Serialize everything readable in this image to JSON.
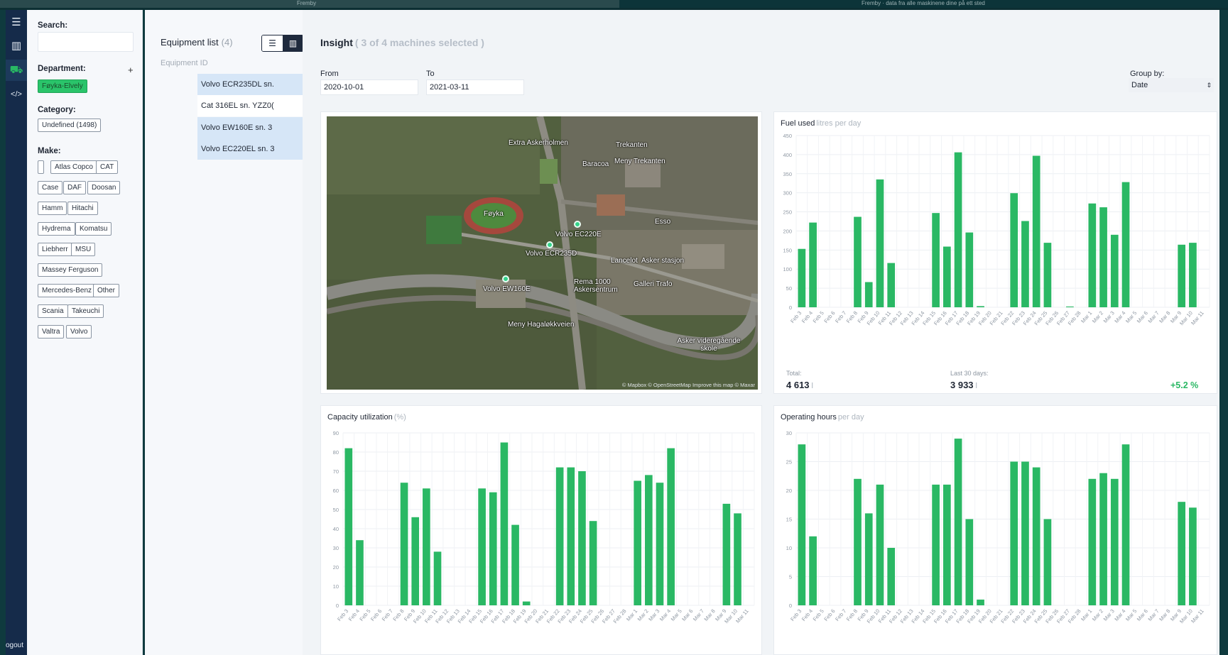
{
  "topbar": {
    "left_text": "Fremby",
    "right_text": "Fremby · data fra alle maskinene dine på ett sted"
  },
  "rail": {
    "items": [
      {
        "icon": "menu-icon",
        "glyph": "☰"
      },
      {
        "icon": "building-icon",
        "glyph": "▥"
      },
      {
        "icon": "machine-icon",
        "glyph": "⛟"
      },
      {
        "icon": "code-icon",
        "glyph": "</>"
      }
    ],
    "logout_label": "ogout"
  },
  "filters": {
    "search_label": "Search:",
    "search_value": "",
    "department_label": "Department:",
    "department_add": "+",
    "department_chips": [
      "Føyka-Elvely"
    ],
    "category_label": "Category:",
    "category_chips": [
      "Undefined (1498)"
    ],
    "make_label": "Make:",
    "make_chips": [
      "",
      "Atlas Copco",
      "CAT",
      "Case",
      "DAF",
      "Doosan",
      "Hamm",
      "Hitachi",
      "Hydrema",
      "Komatsu",
      "Liebherr",
      "MSU",
      "Massey Ferguson",
      "Mercedes-Benz",
      "Other",
      "Scania",
      "Takeuchi",
      "Valtra",
      "Volvo"
    ]
  },
  "equipment": {
    "title": "Equipment list",
    "count": "(4)",
    "column_header": "Equipment ID",
    "rows": [
      {
        "label": "Volvo ECR235DL sn.",
        "selected": true
      },
      {
        "label": "Cat 316EL sn. YZZ0(",
        "selected": false
      },
      {
        "label": "Volvo EW160E sn. 3",
        "selected": true
      },
      {
        "label": "Volvo EC220EL sn. 3",
        "selected": true
      }
    ]
  },
  "insight": {
    "title": "Insight",
    "subtitle": "( 3 of 4 machines selected )",
    "from_label": "From",
    "from_value": "2020-10-01",
    "to_label": "To",
    "to_value": "2021-03-11",
    "group_label": "Group by:",
    "group_value": "Date"
  },
  "map": {
    "labels": [
      "Extra Askerholmen",
      "Trekanten",
      "Baracoa",
      "Meny Trekanten",
      "Føyka",
      "Volvo EC220E",
      "Volvo ECR235D",
      "Volvo EW160E",
      "Lancelot",
      "Asker stasjon",
      "Rema 1000 Askersentrum",
      "Galleri Trafo",
      "Meny Hagaløkkveien",
      "Asker videregående skole",
      "Esso"
    ],
    "attribution": "© Mapbox © OpenStreetMap Improve this map © Maxar"
  },
  "colors": {
    "bar": "#2ab864",
    "accent": "#2ac46a",
    "rail": "#152b4a"
  },
  "fuel_stats": {
    "total_label": "Total:",
    "total_value": "4 613",
    "total_unit": "l",
    "last30_label": "Last 30 days:",
    "last30_value": "3 933",
    "last30_unit": "l",
    "change": "+5.2 %"
  },
  "chart_data": [
    {
      "id": "fuel",
      "type": "bar",
      "title": "Fuel used",
      "unit_label": "litres per day",
      "ylim": [
        0,
        450
      ],
      "yticks": [
        0,
        50,
        100,
        150,
        200,
        250,
        300,
        350,
        400,
        450
      ],
      "grid": true,
      "categories": [
        "Feb 3",
        "Feb 4",
        "Feb 5",
        "Feb 6",
        "Feb 7",
        "Feb 8",
        "Feb 9",
        "Feb 10",
        "Feb 11",
        "Feb 12",
        "Feb 13",
        "Feb 14",
        "Feb 15",
        "Feb 16",
        "Feb 17",
        "Feb 18",
        "Feb 19",
        "Feb 20",
        "Feb 21",
        "Feb 22",
        "Feb 23",
        "Feb 24",
        "Feb 25",
        "Feb 26",
        "Feb 27",
        "Feb 28",
        "Mar 1",
        "Mar 2",
        "Mar 3",
        "Mar 4",
        "Mar 5",
        "Mar 6",
        "Mar 7",
        "Mar 8",
        "Mar 9",
        "Mar 10",
        "Mar 11"
      ],
      "values": [
        153,
        222,
        0,
        0,
        0,
        237,
        66,
        335,
        116,
        0,
        0,
        0,
        247,
        159,
        406,
        196,
        3,
        0,
        0,
        299,
        226,
        397,
        169,
        0,
        2,
        0,
        272,
        262,
        190,
        328,
        0,
        0,
        0,
        0,
        164,
        169,
        0
      ]
    },
    {
      "id": "capacity",
      "type": "bar",
      "title": "Capacity utilization",
      "unit_label": "(%)",
      "ylim": [
        0,
        90
      ],
      "yticks": [
        0,
        10,
        20,
        30,
        40,
        50,
        60,
        70,
        80,
        90
      ],
      "grid": true,
      "categories": [
        "Feb 3",
        "Feb 4",
        "Feb 5",
        "Feb 6",
        "Feb 7",
        "Feb 8",
        "Feb 9",
        "Feb 10",
        "Feb 11",
        "Feb 12",
        "Feb 13",
        "Feb 14",
        "Feb 15",
        "Feb 16",
        "Feb 17",
        "Feb 18",
        "Feb 19",
        "Feb 20",
        "Feb 21",
        "Feb 22",
        "Feb 23",
        "Feb 24",
        "Feb 25",
        "Feb 26",
        "Feb 27",
        "Feb 28",
        "Mar 1",
        "Mar 2",
        "Mar 3",
        "Mar 4",
        "Mar 5",
        "Mar 6",
        "Mar 7",
        "Mar 8",
        "Mar 9",
        "Mar 10",
        "Mar 11"
      ],
      "values": [
        82,
        34,
        0,
        0,
        0,
        64,
        46,
        61,
        28,
        0,
        0,
        0,
        61,
        59,
        85,
        42,
        2,
        0,
        0,
        72,
        72,
        70,
        44,
        0,
        0,
        0,
        65,
        68,
        64,
        82,
        0,
        0,
        0,
        0,
        53,
        48,
        0
      ]
    },
    {
      "id": "hours",
      "type": "bar",
      "title": "Operating hours",
      "unit_label": "per day",
      "ylim": [
        0,
        30
      ],
      "yticks": [
        0,
        5,
        10,
        15,
        20,
        25,
        30
      ],
      "grid": true,
      "categories": [
        "Feb 3",
        "Feb 4",
        "Feb 5",
        "Feb 6",
        "Feb 7",
        "Feb 8",
        "Feb 9",
        "Feb 10",
        "Feb 11",
        "Feb 12",
        "Feb 13",
        "Feb 14",
        "Feb 15",
        "Feb 16",
        "Feb 17",
        "Feb 18",
        "Feb 19",
        "Feb 20",
        "Feb 21",
        "Feb 22",
        "Feb 23",
        "Feb 24",
        "Feb 25",
        "Feb 26",
        "Feb 27",
        "Feb 28",
        "Mar 1",
        "Mar 2",
        "Mar 3",
        "Mar 4",
        "Mar 5",
        "Mar 6",
        "Mar 7",
        "Mar 8",
        "Mar 9",
        "Mar 10",
        "Mar 11"
      ],
      "values": [
        28,
        12,
        0,
        0,
        0,
        22,
        16,
        21,
        10,
        0,
        0,
        0,
        21,
        21,
        29,
        15,
        1,
        0,
        0,
        25,
        25,
        24,
        15,
        0,
        0,
        0,
        22,
        23,
        22,
        28,
        0,
        0,
        0,
        0,
        18,
        17,
        0
      ]
    }
  ]
}
